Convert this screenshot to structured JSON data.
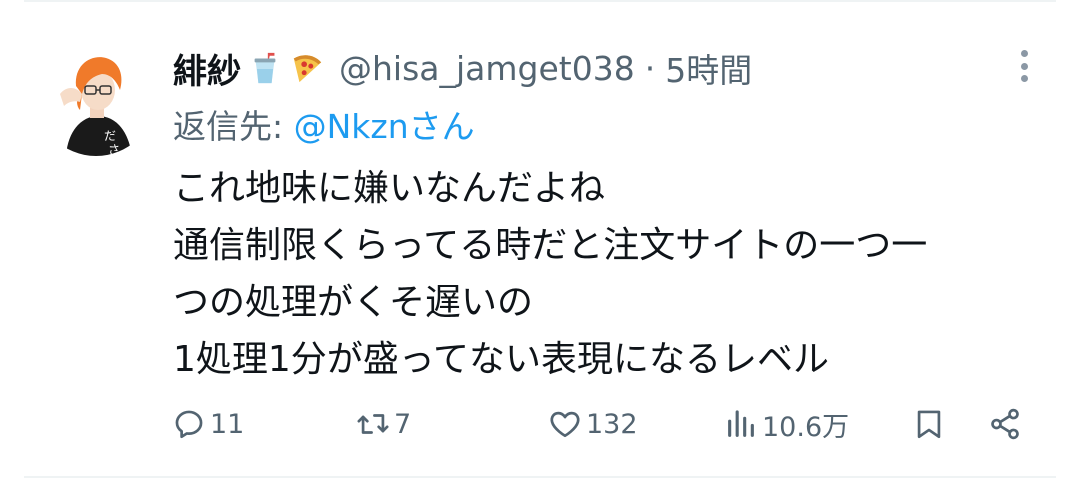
{
  "tweet": {
    "display_name": "緋紗",
    "emojis": [
      "cup-with-straw-icon",
      "pizza-icon"
    ],
    "handle": "@hisa_jamget038",
    "separator": "·",
    "time": "5時間",
    "reply_prefix": "返信先: ",
    "reply_mention": "@Nkznさん",
    "body_lines": [
      "これ地味に嫌いなんだよね",
      "通信制限くらってる時だと注文サイトの一つ一",
      "つの処理がくそ遅いの",
      "1処理1分が盛ってない表現になるレベル"
    ]
  },
  "actions": {
    "reply": {
      "icon": "reply-icon",
      "count": "11"
    },
    "retweet": {
      "icon": "retweet-icon",
      "count": "7"
    },
    "like": {
      "icon": "heart-icon",
      "count": "132"
    },
    "views": {
      "icon": "views-icon",
      "count": "10.6万"
    },
    "bookmark": {
      "icon": "bookmark-icon"
    },
    "share": {
      "icon": "share-icon"
    }
  },
  "colors": {
    "text": "#0f1419",
    "secondary": "#536471",
    "accent": "#1d9bf0"
  }
}
